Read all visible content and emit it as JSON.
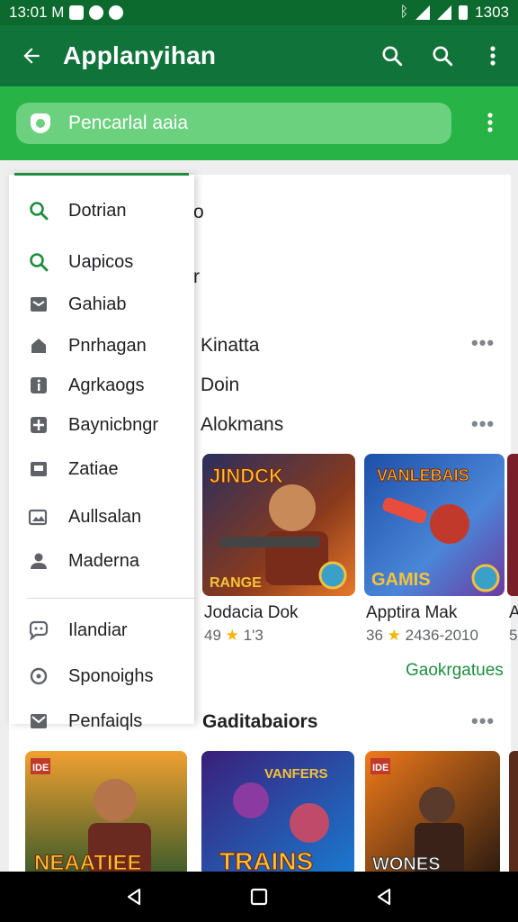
{
  "status_bar": {
    "time": "13:01 M",
    "right_text": "1303"
  },
  "app_bar": {
    "title": "Applanyihan"
  },
  "search": {
    "placeholder": "Pencarlal aaia"
  },
  "drawer": {
    "items": [
      {
        "label": "Dotrian",
        "icon": "search-icon"
      },
      {
        "label": "Uapicos",
        "icon": "search-icon"
      },
      {
        "label": "Gahiab",
        "icon": "inbox-icon"
      },
      {
        "label": "Pnrhagan",
        "icon": "home-icon"
      },
      {
        "label": "Agrkaogs",
        "icon": "info-icon"
      },
      {
        "label": "Baynicbngr",
        "icon": "puzzle-icon"
      },
      {
        "label": "Zatiae",
        "icon": "bookmark-icon"
      },
      {
        "label": "Aullsalan",
        "icon": "gallery-icon"
      },
      {
        "label": "Maderna",
        "icon": "person-icon"
      },
      {
        "label": "Ilandiar",
        "icon": "feedback-icon"
      },
      {
        "label": "Sponoighs",
        "icon": "settings-icon"
      },
      {
        "label": "Penfaiqls",
        "icon": "mail-icon"
      }
    ],
    "accent_color": "#1e8e3e"
  },
  "content": {
    "fragments": [
      "o",
      "r"
    ],
    "rows": [
      {
        "title": "Kinatta"
      },
      {
        "title": "Doin"
      },
      {
        "title": "Alokmans"
      },
      {
        "title": "Gaditabaiors"
      }
    ],
    "games": [
      {
        "art_title": "JINDCK",
        "art_sub": "RANGE",
        "name": "Jodacia Dok",
        "rating": "49",
        "star": "★",
        "meta": "1'3"
      },
      {
        "art_title": "VANLEBAIS",
        "art_sub": "GAMIS",
        "name": "Apptira Mak",
        "rating": "36",
        "star": "★",
        "meta": "2436-2010"
      },
      {
        "name": "A",
        "rating": "5"
      }
    ],
    "see_more": "Gaokrgatues",
    "bottom_tiles": [
      {
        "badge": "IDE",
        "art_title": "NEAATIEE"
      },
      {
        "art_title": "TRAINS",
        "art_top": "VANFERS"
      },
      {
        "badge": "IDE",
        "art_title": "WONES"
      }
    ]
  },
  "colors": {
    "status_bar": "#0d6a2e",
    "app_bar": "#10733a",
    "search_strip": "#28b346",
    "search_box": "#6cd17f",
    "link": "#1e8e3e",
    "star": "#f6b400"
  }
}
